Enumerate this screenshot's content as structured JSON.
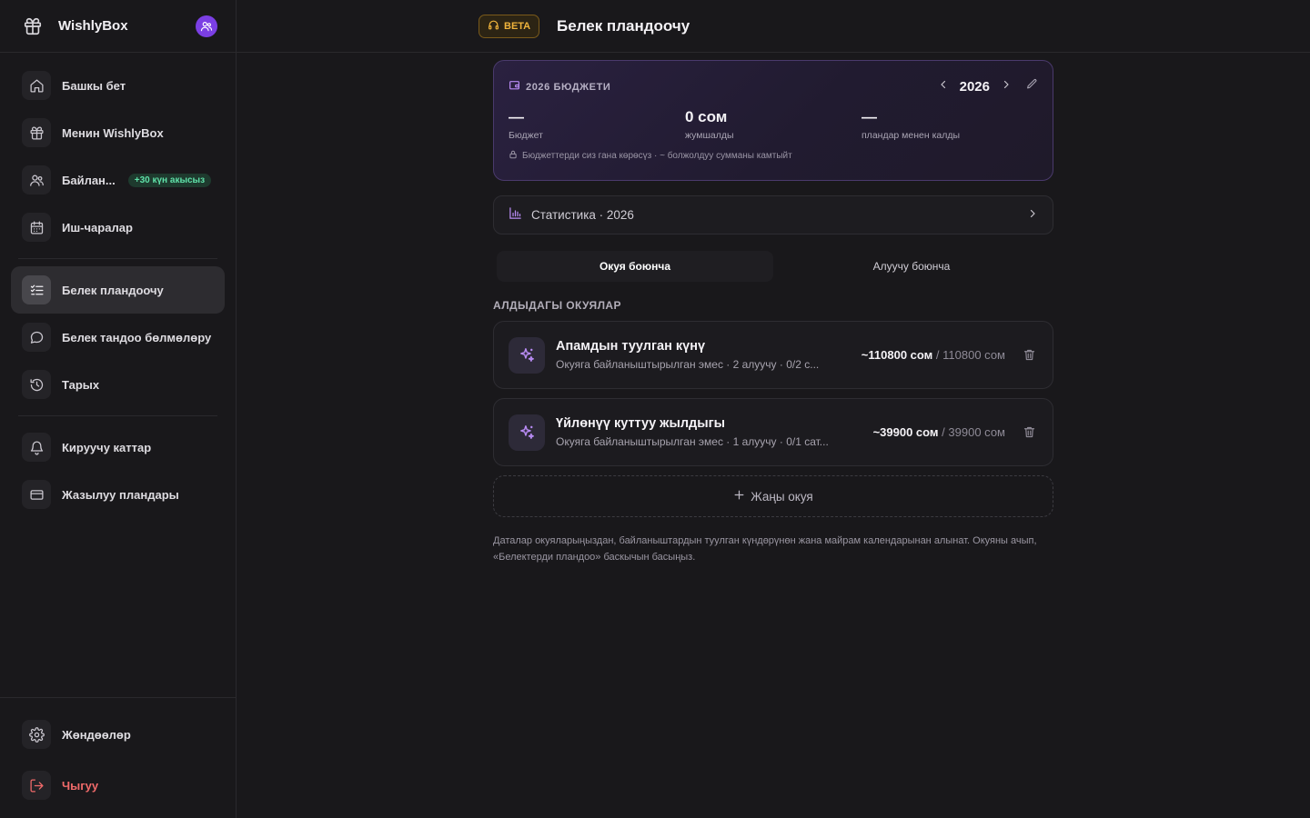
{
  "app": {
    "name": "WishlyBox"
  },
  "sidebar": {
    "items": [
      {
        "label": "Башкы бет",
        "icon": "home-icon"
      },
      {
        "label": "Менин WishlyBox",
        "icon": "gift-icon"
      },
      {
        "label": "Байлан...",
        "icon": "users-icon",
        "badge": "+30 күн акысыз"
      },
      {
        "label": "Иш-чаралар",
        "icon": "calendar-icon"
      },
      {
        "label": "Белек пландоочу",
        "icon": "checklist-icon",
        "active": true
      },
      {
        "label": "Белек тандоо бөлмөлөру",
        "icon": "chat-icon"
      },
      {
        "label": "Тарых",
        "icon": "history-icon"
      },
      {
        "label": "Кируучу каттар",
        "icon": "bell-icon"
      },
      {
        "label": "Жазылуу пландары",
        "icon": "credit-card-icon"
      }
    ],
    "footer": [
      {
        "label": "Жөндөөлөр",
        "icon": "gear-icon"
      },
      {
        "label": "Чыгуу",
        "icon": "logout-icon"
      }
    ]
  },
  "header": {
    "badge": "BETA",
    "title": "Белек пландоочу"
  },
  "budget": {
    "title": "2026 БЮДЖЕТИ",
    "year": "2026",
    "stats": [
      {
        "value": "—",
        "caption": "Бюджет"
      },
      {
        "value": "0 сом",
        "caption": "жумшалды"
      },
      {
        "value": "—",
        "caption": "пландар менен калды"
      }
    ],
    "note": "Бюджеттерди сиз гана көрөсүз · ~ болжолдуу сумманы камтыйт"
  },
  "statistics": {
    "label": "Статистика · 2026"
  },
  "tabs": [
    {
      "label": "Окуя боюнча",
      "active": true
    },
    {
      "label": "Алуучу боюнча",
      "active": false
    }
  ],
  "section_title": "АЛДЫДАГЫ ОКУЯЛАР",
  "events": [
    {
      "title": "Апамдын туулган күнү",
      "subtitle": "Окуяга байланыштырылган эмес · 2 алуучу · 0/2 с...",
      "spent": "~110800 сом",
      "total": "110800 сом"
    },
    {
      "title": "Үйлөнүү куттуу жылдыгы",
      "subtitle": "Окуяга байланыштырылган эмес · 1 алуучу · 0/1 сат...",
      "spent": "~39900 сом",
      "total": "39900 сом"
    }
  ],
  "new_event_label": "Жаңы окуя",
  "footnote": "Даталар окуяларыңыздан, байланыштардын туулган күндөрүнөн жана майрам календарынан алынат. Окуяны ачып, «Белектерди пландоо» баскычын басыңыз.",
  "colors": {
    "accent": "#7b3fe4",
    "accent_icon": "#b98cf5",
    "beta": "#f0b43c",
    "badge_green": "#5fe0a8",
    "danger": "#f06a6a"
  }
}
